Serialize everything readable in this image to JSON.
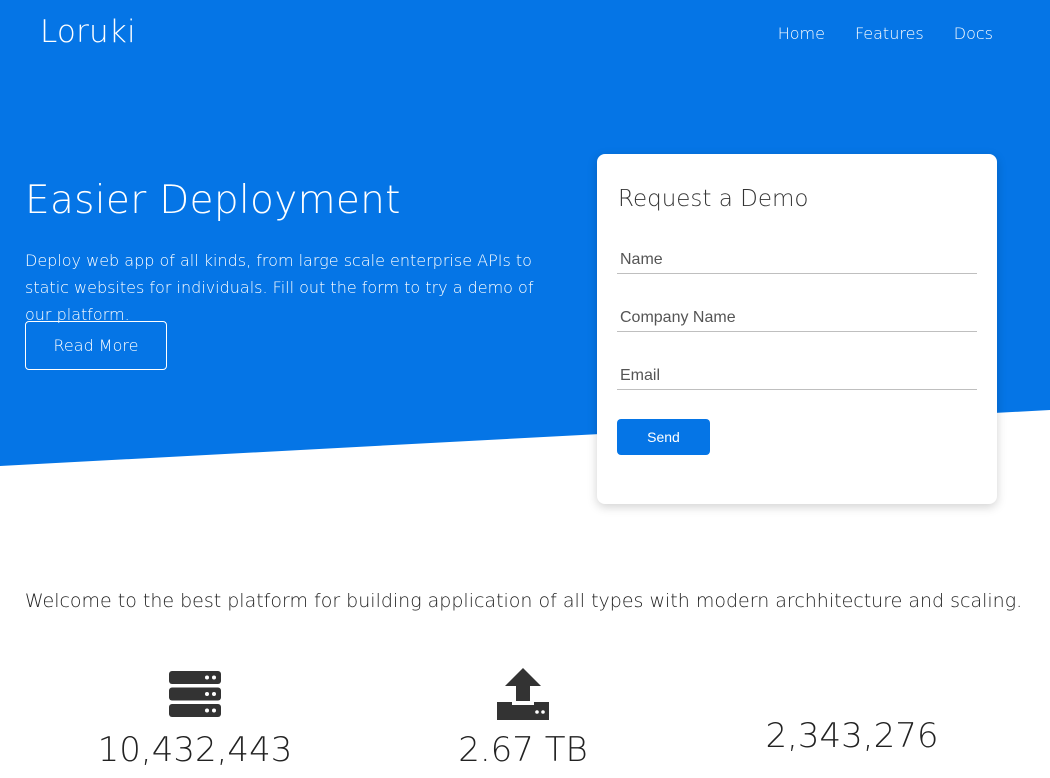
{
  "brand": {
    "name": "Loruki"
  },
  "nav": {
    "items": [
      "Home",
      "Features",
      "Docs"
    ]
  },
  "hero": {
    "title": "Easier Deployment",
    "description": "Deploy web app of all kinds, from large scale enterprise APIs to static websites for individuals. Fill out the form to try a demo of our platform.",
    "button_label": "Read More"
  },
  "demo_form": {
    "title": "Request a Demo",
    "name_placeholder": "Name",
    "company_placeholder": "Company Name",
    "email_placeholder": "Email",
    "send_label": "Send"
  },
  "welcome": {
    "text": "Welcome to the best platform for building application of all types with modern archhitecture and scaling."
  },
  "stats": [
    {
      "icon": "server-icon",
      "value": "10,432,443"
    },
    {
      "icon": "upload-icon",
      "value": "2.67 TB"
    },
    {
      "icon": "",
      "value": "2,343,276"
    }
  ],
  "colors": {
    "primary": "#0575e6",
    "text": "#333333",
    "icon": "#333333"
  }
}
